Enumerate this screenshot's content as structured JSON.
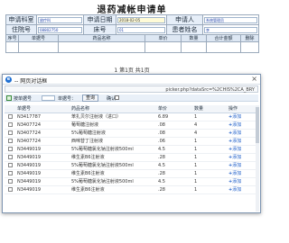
{
  "form": {
    "title": "退药减帐申请单",
    "apply_dept_label": "申请科室",
    "apply_dept_value": "放疗科",
    "apply_date_label": "申请日期",
    "apply_date_value": "2018-02-05",
    "applicant_label": "申请人",
    "applicant_value": "系统管理员",
    "hospital_no_label": "住院号",
    "hospital_no_value": "08802750",
    "bed_label": "床号",
    "bed_value": "01",
    "patient_label": "患者姓名",
    "patient_value": "李",
    "columns": [
      "序号",
      "单据号",
      "药品名称",
      "单价",
      "数量",
      "合计金额",
      "删除"
    ],
    "pager": "1 第1页 共1页"
  },
  "dialog": {
    "title": "-- 网页对话框",
    "close": "×",
    "url": "picker.php?dataSrc=%2CHIS%2CA_BRY",
    "toolbar": {
      "filter_label": "按单据号",
      "doc_label": "单据号：",
      "query_button": "查询",
      "confirm_label": "确认"
    },
    "columns": [
      "",
      "单据号",
      "药品名称",
      "单价",
      "数量",
      "操作"
    ],
    "rows": [
      {
        "doc": "N3417787",
        "name": "苯扎贝尔注射液（进口）",
        "price": "6.89",
        "qty": "1",
        "action": "添加"
      },
      {
        "doc": "N3407724",
        "name": "葡萄糖注射液",
        "price": ".08",
        "qty": "4",
        "action": "添加"
      },
      {
        "doc": "N3407724",
        "name": "5%葡萄糖注射液",
        "price": ".08",
        "qty": "4",
        "action": "添加"
      },
      {
        "doc": "N3407724",
        "name": "西咪替丁注射液",
        "price": ".06",
        "qty": "1",
        "action": "添加"
      },
      {
        "doc": "N3449019",
        "name": "5%葡萄糖氯化钠注射液500ml",
        "price": "4.5",
        "qty": "1",
        "action": "添加"
      },
      {
        "doc": "N3449019",
        "name": "维生素B6注射液",
        "price": ".28",
        "qty": "1",
        "action": "添加"
      },
      {
        "doc": "N3449019",
        "name": "5%葡萄糖氯化钠注射液500ml",
        "price": "4.5",
        "qty": "1",
        "action": "添加"
      },
      {
        "doc": "N3449019",
        "name": "维生素B6注射液",
        "price": ".28",
        "qty": "1",
        "action": "添加"
      },
      {
        "doc": "N3449019",
        "name": "5%葡萄糖氯化钠注射液500ml",
        "price": "4.5",
        "qty": "1",
        "action": "添加"
      },
      {
        "doc": "N3449019",
        "name": "维生素B6注射液",
        "price": ".28",
        "qty": "1",
        "action": "添加"
      }
    ]
  }
}
